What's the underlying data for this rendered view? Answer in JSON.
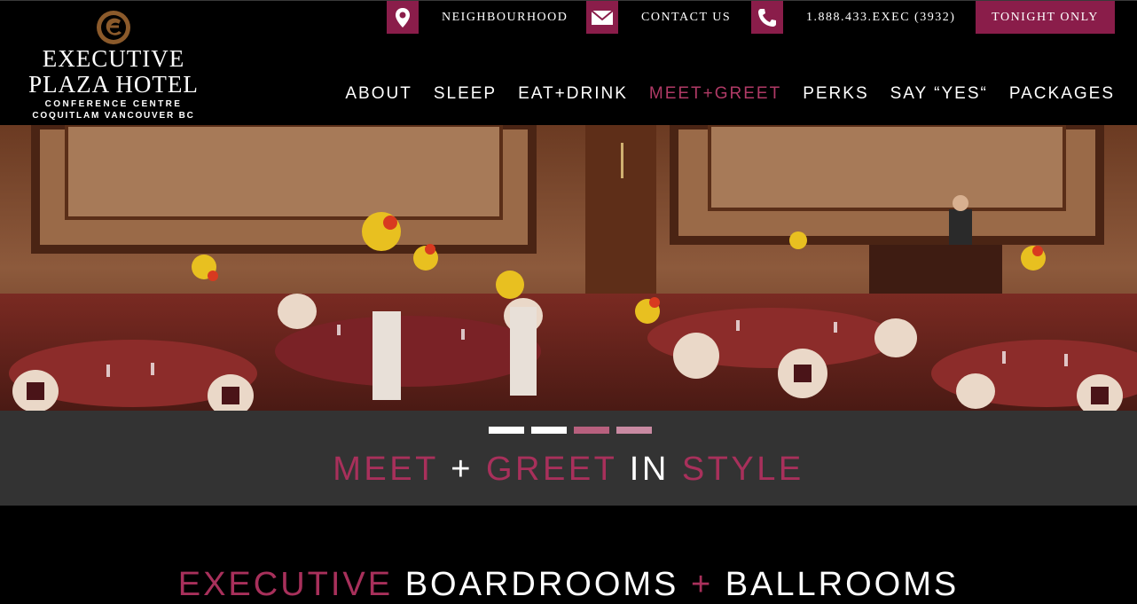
{
  "logo": {
    "line1": "Executive",
    "line2": "Plaza Hotel",
    "line3": "CONFERENCE CENTRE",
    "line4": "COQUITLAM VANCOUVER BC"
  },
  "utility": {
    "neighbourhood": {
      "label": "NEIGHBOURHOOD",
      "icon": "map-pin-icon"
    },
    "contact": {
      "label": "CONTACT US",
      "icon": "envelope-icon"
    },
    "phone": {
      "label": "1.888.433.EXEC (3932)",
      "icon": "phone-icon"
    },
    "tonight": "TONIGHT ONLY"
  },
  "nav": {
    "about": "ABOUT",
    "sleep": "SLEEP",
    "eat": "EAT",
    "plus": "+",
    "drink": "DRINK",
    "meet_greet": "MEET+GREET",
    "perks": "PERKS",
    "say": "SAY “",
    "yes": "YES",
    "say_close": "“",
    "packages": "PACKAGES"
  },
  "slider": {
    "active_index": 3,
    "count": 4
  },
  "caption": {
    "meet": "MEET",
    "plus": "+",
    "greet": "GREET",
    "in": "IN",
    "style": "STYLE"
  },
  "section": {
    "executive": "EXECUTIVE",
    "boardrooms": "BOARDROOMS",
    "plus": "+",
    "ballrooms": "BALLROOMS"
  },
  "colors": {
    "accent": "#8a1d4a",
    "accent_text": "#a8305b",
    "header_bg": "#000000",
    "caption_bg": "#333333"
  }
}
